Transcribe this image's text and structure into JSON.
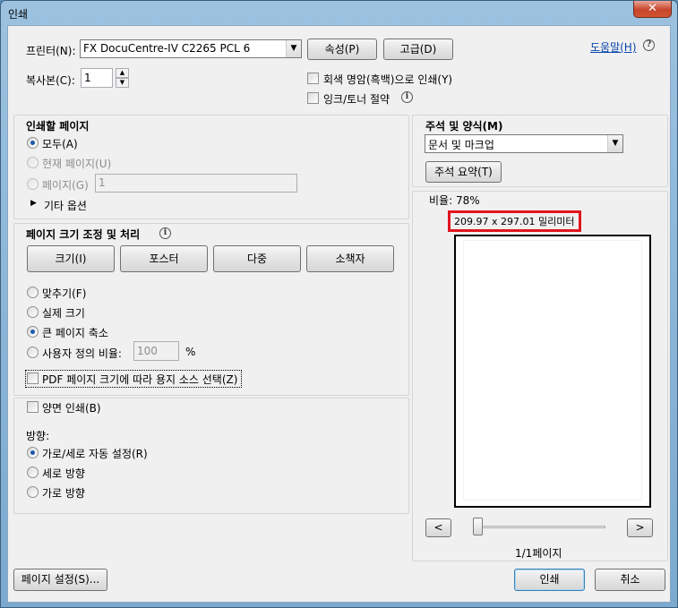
{
  "window": {
    "title": "인쇄",
    "close_glyph": "✕"
  },
  "printer": {
    "label": "프린터(N):",
    "value": "FX DocuCentre-IV C2265 PCL 6",
    "properties_button": "속성(P)",
    "advanced_button": "고급(D)",
    "help_link": "도움말(H)",
    "copies_label": "복사본(C):",
    "copies_value": "1",
    "grayscale_label": "회색 명암(흑백)으로 인쇄(Y)",
    "save_ink_label": "잉크/토너 절약"
  },
  "pages": {
    "header": "인쇄할 페이지",
    "all": "모두(A)",
    "current": "현재 페이지(U)",
    "pages": "페이지(G)",
    "pages_value": "1",
    "more_options": "기타 옵션"
  },
  "sizing": {
    "header": "페이지 크기 조정 및 처리",
    "tabs": [
      "크기(I)",
      "포스터",
      "다중",
      "소책자"
    ],
    "fit": "맞추기(F)",
    "actual": "실제 크기",
    "shrink": "큰 페이지 축소",
    "custom": "사용자 정의 비율:",
    "custom_value": "100",
    "percent": "%",
    "pdf_source": "PDF 페이지 크기에 따라 용지 소스 선택(Z)"
  },
  "duplex": {
    "label": "양면 인쇄(B)",
    "orientation_label": "방향:",
    "auto": "가로/세로 자동 설정(R)",
    "portrait": "세로 방향",
    "landscape": "가로 방향"
  },
  "comments": {
    "header": "주석 및 양식(M)",
    "value": "문서 및 마크업",
    "summary_button": "주석 요약(T)"
  },
  "preview": {
    "scale": "비율: 78%",
    "size": "209.97 x 297.01 밀리미터",
    "prev": "<",
    "next": ">",
    "page_count": "1/1페이지",
    "highlight_color": "#e0141e"
  },
  "footer": {
    "page_setup": "페이지 설정(S)...",
    "print": "인쇄",
    "cancel": "취소"
  },
  "icons": {
    "combo_arrow": "▼",
    "info": "i",
    "triangle": "▶"
  }
}
